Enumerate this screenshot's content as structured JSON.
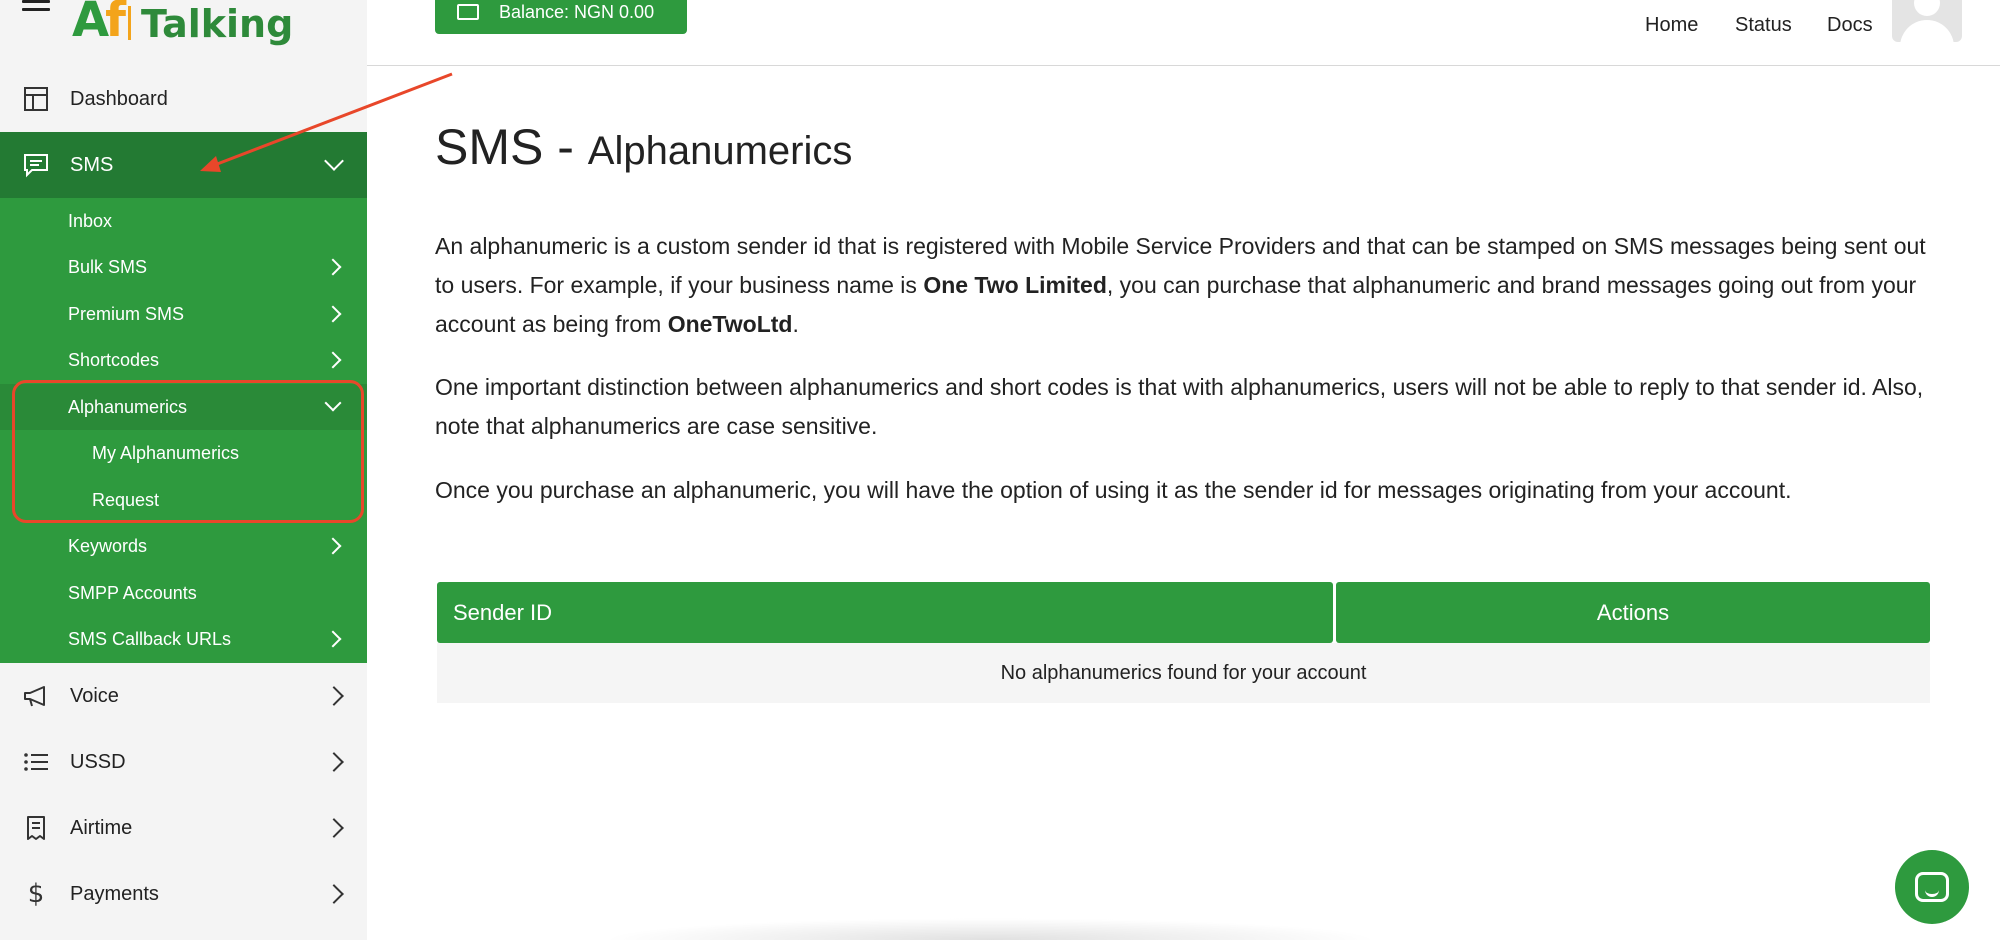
{
  "brand": {
    "logo_mark_a": "A",
    "logo_mark_o": "f",
    "logo_text": "Talking"
  },
  "header": {
    "balance_label": "Balance: NGN 0.00",
    "links": [
      "Home",
      "Status",
      "Docs"
    ]
  },
  "sidebar": {
    "dashboard": "Dashboard",
    "sms": "SMS",
    "sms_items": {
      "inbox": "Inbox",
      "bulk_sms": "Bulk SMS",
      "premium_sms": "Premium SMS",
      "shortcodes": "Shortcodes",
      "alphanumerics": "Alphanumerics",
      "my_alphanumerics": "My Alphanumerics",
      "request": "Request",
      "keywords": "Keywords",
      "smpp_accounts": "SMPP Accounts",
      "sms_callback_urls": "SMS Callback URLs"
    },
    "voice": "Voice",
    "ussd": "USSD",
    "airtime": "Airtime",
    "payments": "Payments"
  },
  "main": {
    "title_main": "SMS - ",
    "title_sub": "Alphanumerics",
    "para1_a": "An alphanumeric is a custom sender id that is registered with Mobile Service Providers and that can be stamped on SMS messages being sent out to users. For example, if your business name is ",
    "para1_b": "One Two Limited",
    "para1_c": ", you can purchase that alphanumeric and brand messages going out from your account as being from ",
    "para1_d": "OneTwoLtd",
    "para1_e": ".",
    "para2": "One important distinction between alphanumerics and short codes is that with alphanumerics, users will not be able to reply to that sender id. Also, note that alphanumerics are case sensitive.",
    "para3": "Once you purchase an alphanumeric, you will have the option of using it as the sender id for messages originating from your account.",
    "table": {
      "col_sender": "Sender ID",
      "col_actions": "Actions",
      "empty": "No alphanumerics found for your account"
    }
  },
  "colors": {
    "brand_green": "#2e9a3e",
    "dark_green": "#237a33",
    "annotation_red": "#e8472a"
  }
}
